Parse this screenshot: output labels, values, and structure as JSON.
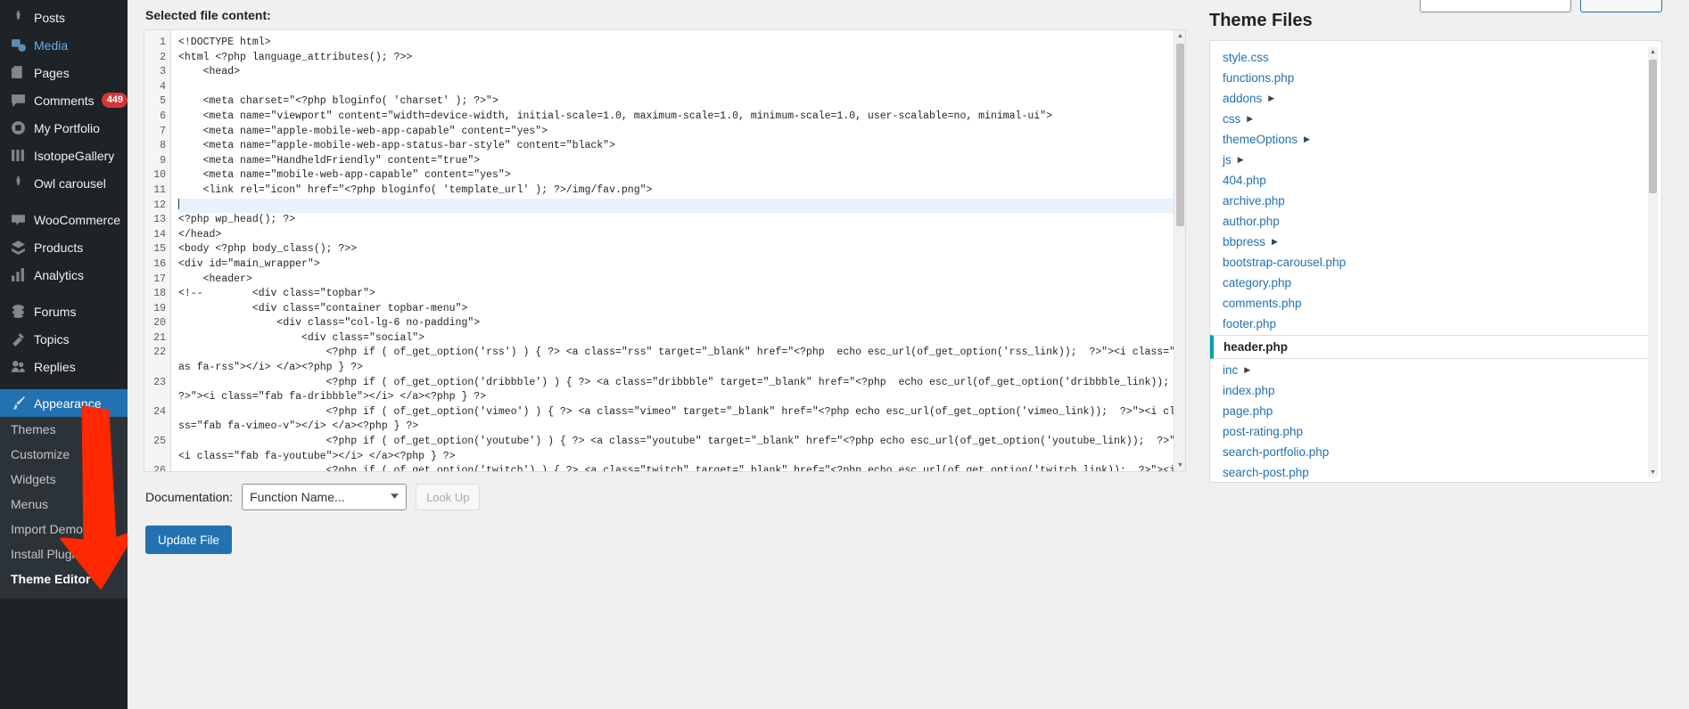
{
  "sidebar": {
    "items": [
      {
        "label": "Posts",
        "icon": "pin-icon",
        "state": "normal"
      },
      {
        "label": "Media",
        "icon": "media-icon",
        "state": "hovered"
      },
      {
        "label": "Pages",
        "icon": "pages-icon",
        "state": "normal"
      },
      {
        "label": "Comments",
        "icon": "comment-icon",
        "state": "normal",
        "badge": "449"
      },
      {
        "label": "My Portfolio",
        "icon": "portfolio-icon",
        "state": "normal"
      },
      {
        "label": "IsotopeGallery",
        "icon": "gallery-icon",
        "state": "normal"
      },
      {
        "label": "Owl carousel",
        "icon": "pin-icon",
        "state": "normal"
      },
      {
        "separator": true
      },
      {
        "label": "WooCommerce",
        "icon": "woo-icon",
        "state": "normal"
      },
      {
        "label": "Products",
        "icon": "products-icon",
        "state": "normal"
      },
      {
        "label": "Analytics",
        "icon": "analytics-icon",
        "state": "normal"
      },
      {
        "separator": true
      },
      {
        "label": "Forums",
        "icon": "forums-icon",
        "state": "normal"
      },
      {
        "label": "Topics",
        "icon": "topics-icon",
        "state": "normal"
      },
      {
        "label": "Replies",
        "icon": "replies-icon",
        "state": "normal"
      },
      {
        "separator": true
      },
      {
        "label": "Appearance",
        "icon": "brush-icon",
        "state": "current"
      }
    ],
    "submenu": [
      {
        "label": "Themes",
        "active": false
      },
      {
        "label": "Customize",
        "active": false
      },
      {
        "label": "Widgets",
        "active": false
      },
      {
        "label": "Menus",
        "active": false
      },
      {
        "label": "Import Demo Data",
        "active": false
      },
      {
        "label": "Install Plugins",
        "active": false
      },
      {
        "label": "Theme Editor",
        "active": true
      }
    ],
    "colors": {
      "background": "#1d2327",
      "submenu_bg": "#2c3338",
      "current": "#2271b1",
      "badge": "#d63638"
    }
  },
  "editor": {
    "selected_file_label": "Selected file content:",
    "active_line": 12,
    "lines": [
      {
        "n": 1,
        "text": "<!DOCTYPE html>"
      },
      {
        "n": 2,
        "text": "<html <?php language_attributes(); ?>>"
      },
      {
        "n": 3,
        "text": "    <head>"
      },
      {
        "n": 4,
        "text": ""
      },
      {
        "n": 5,
        "text": "    <meta charset=\"<?php bloginfo( 'charset' ); ?>\">"
      },
      {
        "n": 6,
        "text": "    <meta name=\"viewport\" content=\"width=device-width, initial-scale=1.0, maximum-scale=1.0, minimum-scale=1.0, user-scalable=no, minimal-ui\">"
      },
      {
        "n": 7,
        "text": "    <meta name=\"apple-mobile-web-app-capable\" content=\"yes\">"
      },
      {
        "n": 8,
        "text": "    <meta name=\"apple-mobile-web-app-status-bar-style\" content=\"black\">"
      },
      {
        "n": 9,
        "text": "    <meta name=\"HandheldFriendly\" content=\"true\">"
      },
      {
        "n": 10,
        "text": "    <meta name=\"mobile-web-app-capable\" content=\"yes\">"
      },
      {
        "n": 11,
        "text": "    <link rel=\"icon\" href=\"<?php bloginfo( 'template_url' ); ?>/img/fav.png\">"
      },
      {
        "n": 12,
        "text": ""
      },
      {
        "n": 13,
        "text": "<?php wp_head(); ?>"
      },
      {
        "n": 14,
        "text": "</head>"
      },
      {
        "n": 15,
        "text": "<body <?php body_class(); ?>>"
      },
      {
        "n": 16,
        "text": "<div id=\"main_wrapper\">"
      },
      {
        "n": 17,
        "text": "    <header>"
      },
      {
        "n": 18,
        "text": "<!--        <div class=\"topbar\">"
      },
      {
        "n": 19,
        "text": "            <div class=\"container topbar-menu\">"
      },
      {
        "n": 20,
        "text": "                <div class=\"col-lg-6 no-padding\">"
      },
      {
        "n": 21,
        "text": "                    <div class=\"social\">"
      },
      {
        "n": 22,
        "text": "                        <?php if ( of_get_option('rss') ) { ?> <a class=\"rss\" target=\"_blank\" href=\"<?php  echo esc_url(of_get_option('rss_link));  ?>\"><i class=\"fas fa-rss\"></i> </a><?php } ?>"
      },
      {
        "n": 23,
        "text": "                        <?php if ( of_get_option('dribbble') ) { ?> <a class=\"dribbble\" target=\"_blank\" href=\"<?php  echo esc_url(of_get_option('dribbble_link));  ?>\"><i class=\"fab fa-dribbble\"></i> </a><?php } ?>"
      },
      {
        "n": 24,
        "text": "                        <?php if ( of_get_option('vimeo') ) { ?> <a class=\"vimeo\" target=\"_blank\" href=\"<?php echo esc_url(of_get_option('vimeo_link));  ?>\"><i class=\"fab fa-vimeo-v\"></i> </a><?php } ?>"
      },
      {
        "n": 25,
        "text": "                        <?php if ( of_get_option('youtube') ) { ?> <a class=\"youtube\" target=\"_blank\" href=\"<?php echo esc_url(of_get_option('youtube_link));  ?>\"><i class=\"fab fa-youtube\"></i> </a><?php } ?>"
      },
      {
        "n": 26,
        "text": "                        <?php if ( of_get_option('twitch') ) { ?> <a class=\"twitch\" target=\"_blank\" href=\"<?php echo esc_url(of_get_option('twitch_link));  ?>\"><i class=\"fab"
      }
    ]
  },
  "documentation": {
    "label": "Documentation:",
    "select_value": "Function Name...",
    "lookup_label": "Look Up"
  },
  "actions": {
    "update_file_label": "Update File"
  },
  "theme_files": {
    "title": "Theme Files",
    "items": [
      {
        "name": "style.css",
        "folder": false,
        "selected": false
      },
      {
        "name": "functions.php",
        "folder": false,
        "selected": false
      },
      {
        "name": "addons",
        "folder": true,
        "selected": false
      },
      {
        "name": "css",
        "folder": true,
        "selected": false
      },
      {
        "name": "themeOptions",
        "folder": true,
        "selected": false
      },
      {
        "name": "js",
        "folder": true,
        "selected": false
      },
      {
        "name": "404.php",
        "folder": false,
        "selected": false
      },
      {
        "name": "archive.php",
        "folder": false,
        "selected": false
      },
      {
        "name": "author.php",
        "folder": false,
        "selected": false
      },
      {
        "name": "bbpress",
        "folder": true,
        "selected": false
      },
      {
        "name": "bootstrap-carousel.php",
        "folder": false,
        "selected": false
      },
      {
        "name": "category.php",
        "folder": false,
        "selected": false
      },
      {
        "name": "comments.php",
        "folder": false,
        "selected": false
      },
      {
        "name": "footer.php",
        "folder": false,
        "selected": false
      },
      {
        "name": "header.php",
        "folder": false,
        "selected": true
      },
      {
        "name": "inc",
        "folder": true,
        "selected": false
      },
      {
        "name": "index.php",
        "folder": false,
        "selected": false
      },
      {
        "name": "page.php",
        "folder": false,
        "selected": false
      },
      {
        "name": "post-rating.php",
        "folder": false,
        "selected": false
      },
      {
        "name": "search-portfolio.php",
        "folder": false,
        "selected": false
      },
      {
        "name": "search-post.php",
        "folder": false,
        "selected": false
      }
    ],
    "colors": {
      "link": "#2271b1",
      "selected_accent": "#00a0a8"
    }
  },
  "annotation": {
    "arrow_color": "#ff2800",
    "points_to": "Theme Editor"
  }
}
